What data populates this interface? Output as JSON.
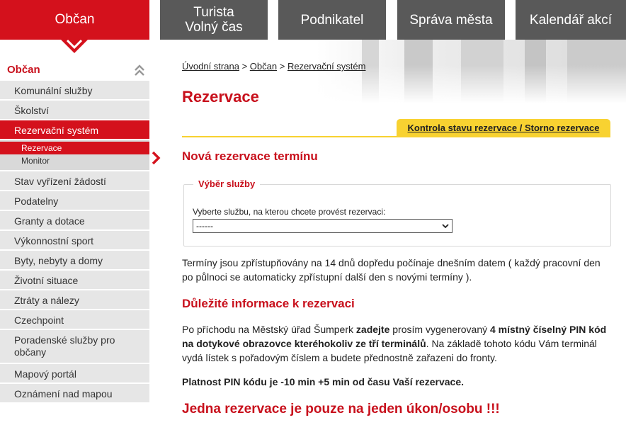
{
  "topnav": {
    "active": "Občan",
    "tabs": [
      {
        "line1": "Turista",
        "line2": "Volný čas"
      },
      {
        "line1": "Podnikatel",
        "line2": ""
      },
      {
        "line1": "Správa města",
        "line2": ""
      },
      {
        "line1": "Kalendář akcí",
        "line2": ""
      }
    ]
  },
  "sidebar": {
    "heading": "Občan",
    "items_before": [
      "Komunální služby",
      "Školství"
    ],
    "active_item": "Rezervační systém",
    "sub_items": [
      "Rezervace",
      "Monitor"
    ],
    "items_after": [
      "Stav vyřízení žádostí",
      "Podatelny",
      "Granty a dotace",
      "Výkonnostní sport",
      "Byty, nebyty a domy",
      "Životní situace",
      "Ztráty a nálezy",
      "Czechpoint"
    ],
    "tall_item_line1": "Poradenské služby pro",
    "tall_item_line2": "občany",
    "items_end": [
      "Mapový portál",
      "Oznámení nad mapou"
    ]
  },
  "breadcrumb": {
    "home": "Úvodní strana",
    "sep": ">",
    "section": "Občan",
    "current": "Rezervační systém"
  },
  "page": {
    "title": "Rezervace",
    "control_tab": "Kontrola stavu rezervace / Storno rezervace",
    "new_heading": "Nová rezervace termínu",
    "legend": "Výběr služby",
    "field_label": "Vyberte službu, na kterou chcete provést rezervaci:",
    "select_value": "------",
    "terms_text": "Termíny jsou zpřístupňovány na 14 dnů dopředu počínaje dnešním datem ( každý pracovní den po půlnoci se automaticky zpřístupní další den s novými termíny ).",
    "info_heading": "Důležité informace k rezervaci",
    "pin_1": "Po příchodu na Městský úřad Šumperk ",
    "pin_2": "zadejte",
    "pin_3": " prosím vygenerovaný ",
    "pin_4": "4 místný číselný PIN kód na dotykové obrazovce kteréhokoliv ze tří terminálů",
    "pin_5": ". Na základě tohoto kódu Vám terminál vydá lístek s pořadovým číslem a budete přednostně zařazeni do fronty.",
    "validity": "Platnost PIN kódu je -10 min +5 min od času Vaší rezervace.",
    "one_per_person": "Jedna rezervace je pouze na jeden úkon/osobu !!!"
  },
  "colors": {
    "brand_red": "#d4111c",
    "tab_gray": "#595959",
    "accent_yellow": "#f8d231"
  }
}
